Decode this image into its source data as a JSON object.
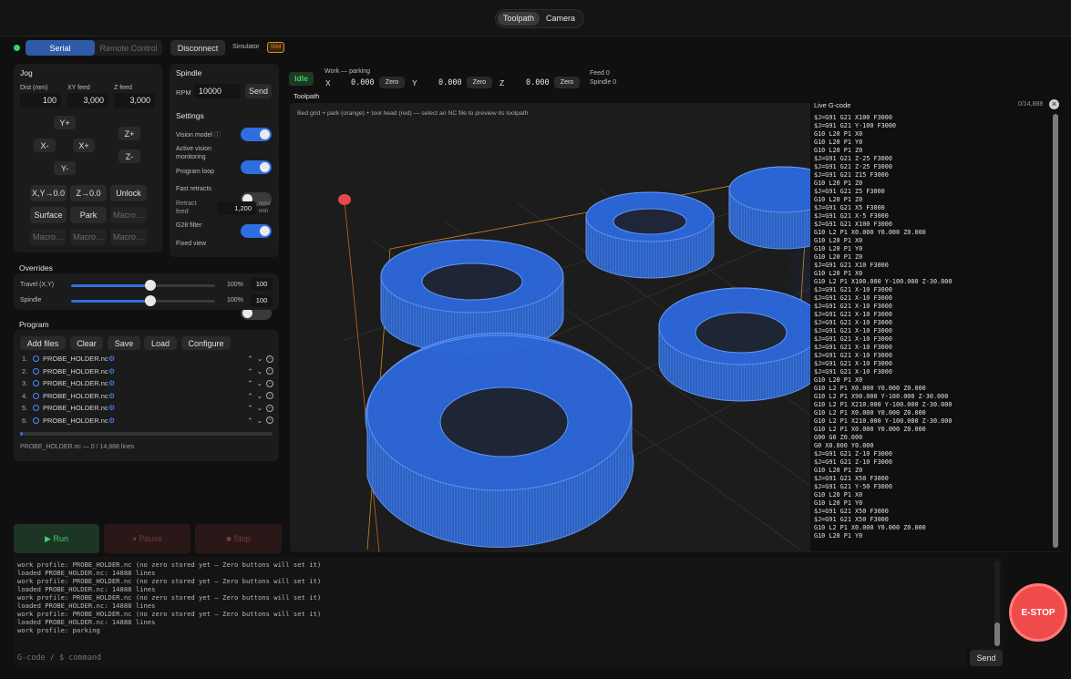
{
  "tabs": {
    "toolpath": "Toolpath",
    "camera": "Camera"
  },
  "conn": {
    "serial": "Serial",
    "remote": "Remote Control",
    "disconnect": "Disconnect",
    "simulator": "Simulator",
    "sim_badge": "SIM"
  },
  "jog": {
    "title": "Jog",
    "dist_label": "Dist (mm)",
    "dist": "100",
    "xyfeed_label": "XY feed",
    "xyfeed": "3,000",
    "zfeed_label": "Z feed",
    "zfeed": "3,000",
    "yplus": "Y+",
    "xminus": "X-",
    "xplus": "X+",
    "yminus": "Y-",
    "zplus": "Z+",
    "zminus": "Z-",
    "xyzero": "X,Y→0.0",
    "zzero": "Z→0.0",
    "unlock": "Unlock",
    "surface": "Surface",
    "park": "Park",
    "macro": "Macro…"
  },
  "spindle": {
    "title": "Spindle",
    "rpm_label": "RPM",
    "rpm": "10000",
    "send": "Send"
  },
  "settings": {
    "title": "Settings",
    "model": "Vision model",
    "active_vision": "Active vision monitoring",
    "loop": "Program loop",
    "fast": "Fast retracts",
    "retract_label": "Retract feed",
    "retract": "1,200",
    "retract_unit": "mm/ min",
    "g28": "G28 filter",
    "fixed": "Fixed view",
    "info_icon": "ⓘ"
  },
  "overrides": {
    "title": "Overrides",
    "travel_label": "Travel (X,Y)",
    "travel_pct": "100%",
    "travel_val": "100",
    "spindle_label": "Spindle",
    "spindle_pct": "100%",
    "spindle_val": "100",
    "travel_level": 0.55,
    "spindle_level": 0.55
  },
  "program": {
    "title": "Program",
    "add": "Add files",
    "clear": "Clear",
    "save": "Save",
    "load": "Load",
    "configure": "Configure",
    "files": [
      {
        "n": "1.",
        "name": "PROBE_HOLDER.nc"
      },
      {
        "n": "2.",
        "name": "PROBE_HOLDER.nc"
      },
      {
        "n": "3.",
        "name": "PROBE_HOLDER.nc"
      },
      {
        "n": "4.",
        "name": "PROBE_HOLDER.nc"
      },
      {
        "n": "5.",
        "name": "PROBE_HOLDER.nc"
      },
      {
        "n": "6.",
        "name": "PROBE_HOLDER.nc"
      }
    ],
    "status": "PROBE_HOLDER.nc — 0 / 14,888 lines"
  },
  "run": {
    "run": "▶ Run",
    "pause": "⏸ Pause",
    "stop": "■ Stop"
  },
  "dro": {
    "state": "Idle",
    "work": "Work — parking",
    "x_label": "X",
    "x": "0.000",
    "y_label": "Y",
    "y": "0.000",
    "z_label": "Z",
    "z": "0.000",
    "zero": "Zero",
    "feed": "Feed 0",
    "spindle": "Spindle 0"
  },
  "viewport": {
    "title": "Toolpath",
    "hint": "Bed grid + park (orange) + tool head (red) — select an NC file to preview its toolpath"
  },
  "gcode": {
    "title": "Live G-code",
    "count": "0/14,888",
    "close": "×",
    "lines": [
      "$J=G91 G21 X100 F3000",
      "$J=G91 G21 Y-100 F3000",
      "G10 L20 P1 X0",
      "G10 L20 P1 Y0",
      "G10 L20 P1 Z0",
      "$J=G91 G21 Z-25 F3000",
      "$J=G91 G21 Z-25 F3000",
      "$J=G91 G21 Z15 F3000",
      "G10 L20 P1 Z0",
      "$J=G91 G21 Z5 F3000",
      "G10 L20 P1 Z0",
      "$J=G91 G21 X5 F3000",
      "$J=G91 G21 X-5 F3000",
      "$J=G91 G21 X100 F3000",
      "G10 L2 P1 X0.000 Y0.000 Z0.000",
      "G10 L20 P1 X0",
      "G10 L20 P1 Y0",
      "G10 L20 P1 Z0",
      "$J=G91 G21 X10 F3000",
      "G10 L20 P1 X0",
      "G10 L2 P1 X100.000 Y-100.000 Z-30.000",
      "$J=G91 G21 X-10 F3000",
      "$J=G91 G21 X-10 F3000",
      "$J=G91 G21 X-10 F3000",
      "$J=G91 G21 X-10 F3000",
      "$J=G91 G21 X-10 F3000",
      "$J=G91 G21 X-10 F3000",
      "$J=G91 G21 X-10 F3000",
      "$J=G91 G21 X-10 F3000",
      "$J=G91 G21 X-10 F3000",
      "$J=G91 G21 X-10 F3000",
      "$J=G91 G21 X-10 F3000",
      "G10 L20 P1 X0",
      "G10 L2 P1 X0.000 Y0.000 Z0.000",
      "G10 L2 P1 X90.000 Y-100.000 Z-30.000",
      "G10 L2 P1 X210.000 Y-100.000 Z-30.000",
      "G10 L2 P1 X0.000 Y0.000 Z0.000",
      "G10 L2 P1 X210.000 Y-100.000 Z-30.000",
      "G10 L2 P1 X0.000 Y0.000 Z0.000",
      "G90 G0 Z0.000",
      "G0 X0.000 Y0.000",
      "$J=G91 G21 Z-10 F3000",
      "$J=G91 G21 Z-10 F3000",
      "G10 L20 P1 Z0",
      "$J=G91 G21 X50 F3000",
      "$J=G91 G21 Y-50 F3000",
      "G10 L20 P1 X0",
      "G10 L20 P1 Y0",
      "$J=G91 G21 X50 F3000",
      "$J=G91 G21 X50 F3000",
      "G10 L2 P1 X0.000 Y0.000 Z0.000",
      "G10 L20 P1 Y0"
    ]
  },
  "console": {
    "lines": [
      "work profile: PROBE_HOLDER.nc (no zero stored yet — Zero buttons will set it)",
      "loaded PROBE_HOLDER.nc: 14888 lines",
      "work profile: PROBE_HOLDER.nc (no zero stored yet — Zero buttons will set it)",
      "loaded PROBE_HOLDER.nc: 14888 lines",
      "work profile: PROBE_HOLDER.nc (no zero stored yet — Zero buttons will set it)",
      "loaded PROBE_HOLDER.nc: 14888 lines",
      "work profile: PROBE_HOLDER.nc (no zero stored yet — Zero buttons will set it)",
      "loaded PROBE_HOLDER.nc: 14888 lines",
      "work profile: parking"
    ],
    "placeholder": "G-code / $ command",
    "send": "Send"
  },
  "estop": "E-STOP",
  "colors": {
    "accent": "#2f6ee0",
    "idle": "#3bd16f",
    "estop": "#f04b4b",
    "sim": "#e08a2a",
    "toolpath": "#2a6fe0"
  }
}
